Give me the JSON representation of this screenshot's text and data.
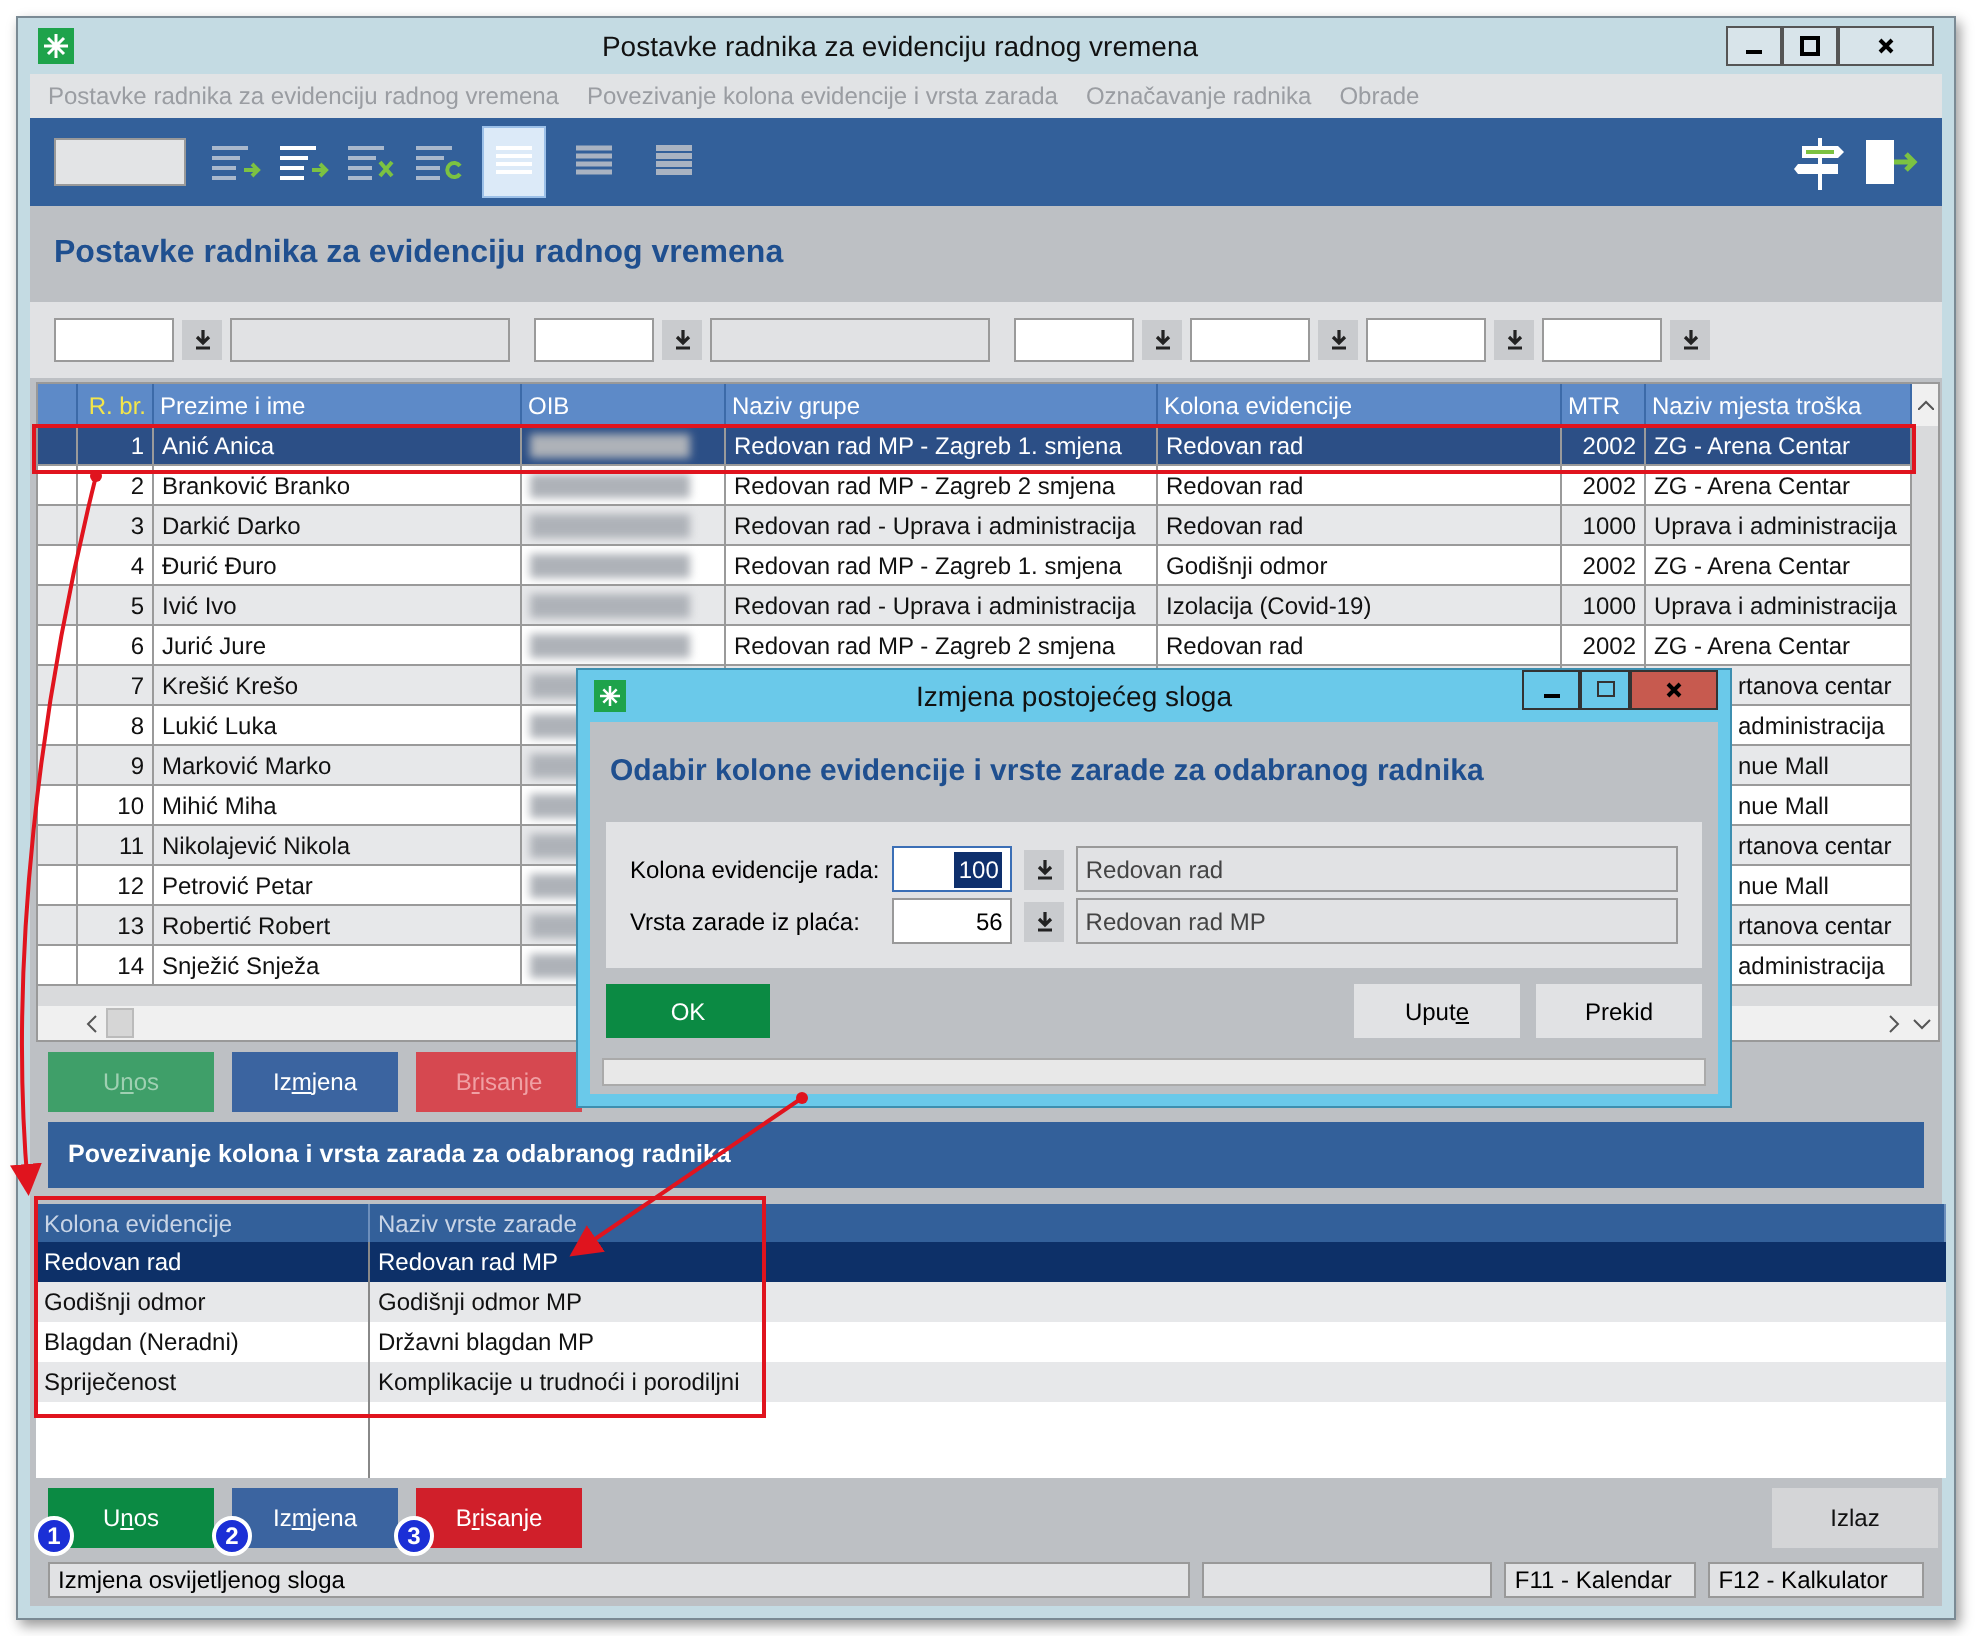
{
  "window": {
    "title": "Postavke radnika za evidenciju radnog vremena"
  },
  "menu": [
    "Postavke radnika za evidenciju radnog vremena",
    "Povezivanje kolona evidencije i vrsta zarada",
    "Označavanje radnika",
    "Obrade"
  ],
  "view_buttons": [
    {
      "selected": true
    },
    {
      "selected": false
    },
    {
      "selected": false
    }
  ],
  "section_title": "Postavke radnika za evidenciju radnog vremena",
  "table": {
    "columns": [
      "R. br.",
      "Prezime i ime",
      "OIB",
      "Naziv grupe",
      "Kolona evidencije",
      "MTR",
      "Naziv mjesta troška"
    ],
    "rows": [
      {
        "no": "1",
        "name": "Anić Anica",
        "group": "Redovan rad MP - Zagreb 1. smjena",
        "kolona": "Redovan rad",
        "mtr": "2002",
        "place": "ZG - Arena Centar",
        "selected": true
      },
      {
        "no": "2",
        "name": "Branković Branko",
        "group": "Redovan rad MP - Zagreb 2 smjena",
        "kolona": "Redovan rad",
        "mtr": "2002",
        "place": "ZG - Arena Centar",
        "selected": false
      },
      {
        "no": "3",
        "name": "Darkić Darko",
        "group": "Redovan rad - Uprava i administracija",
        "kolona": "Redovan rad",
        "mtr": "1000",
        "place": "Uprava i administracija",
        "selected": false
      },
      {
        "no": "4",
        "name": "Đurić Đuro",
        "group": "Redovan rad MP - Zagreb 1. smjena",
        "kolona": "Godišnji odmor",
        "mtr": "2002",
        "place": "ZG - Arena Centar",
        "selected": false
      },
      {
        "no": "5",
        "name": "Ivić Ivo",
        "group": "Redovan rad - Uprava i administracija",
        "kolona": "Izolacija (Covid-19)",
        "mtr": "1000",
        "place": "Uprava i administracija",
        "selected": false
      },
      {
        "no": "6",
        "name": "Jurić Jure",
        "group": "Redovan rad MP - Zagreb 2 smjena",
        "kolona": "Redovan rad",
        "mtr": "2002",
        "place": "ZG - Arena Centar",
        "selected": false
      },
      {
        "no": "7",
        "name": "Krešić Krešo",
        "place": "rtanova centar",
        "selected": false
      },
      {
        "no": "8",
        "name": "Lukić Luka",
        "place": "administracija",
        "selected": false
      },
      {
        "no": "9",
        "name": "Marković Marko",
        "place": "nue Mall",
        "selected": false
      },
      {
        "no": "10",
        "name": "Mihić Miha",
        "place": "nue Mall",
        "selected": false
      },
      {
        "no": "11",
        "name": "Nikolajević Nikola",
        "place": "rtanova centar",
        "selected": false
      },
      {
        "no": "12",
        "name": "Petrović Petar",
        "place": "nue Mall",
        "selected": false
      },
      {
        "no": "13",
        "name": "Robertić Robert",
        "place": "rtanova centar",
        "selected": false
      },
      {
        "no": "14",
        "name": "Snježić Snježa",
        "place": "administracija",
        "selected": false
      }
    ]
  },
  "top_buttons": [
    {
      "label": "Unos",
      "kind": "add",
      "disabled": true
    },
    {
      "label": "Izmjena",
      "kind": "edit",
      "disabled": false
    },
    {
      "label": "Brisanje",
      "kind": "delete",
      "disabled": true
    }
  ],
  "link_section_title": "Povezivanje kolona i vrsta zarada za odabranog radnika",
  "link_table": {
    "columns": [
      "Kolona evidencije",
      "Naziv vrste zarade"
    ],
    "rows": [
      {
        "kolona": "Redovan rad",
        "zarada": "Redovan rad MP",
        "selected": true
      },
      {
        "kolona": "Godišnji odmor",
        "zarada": "Godišnji odmor MP",
        "selected": false
      },
      {
        "kolona": "Blagdan (Neradni)",
        "zarada": "Državni blagdan MP",
        "selected": false
      },
      {
        "kolona": "Spriječenost",
        "zarada": "Komplikacije u trudnoći i porodiljni",
        "selected": false
      }
    ]
  },
  "bottom_buttons": [
    {
      "label": "Unos",
      "kind": "add",
      "disabled": false
    },
    {
      "label": "Izmjena",
      "kind": "edit",
      "disabled": false
    },
    {
      "label": "Brisanje",
      "kind": "delete",
      "disabled": false
    }
  ],
  "exit_button": "Izlaz",
  "markers": [
    "1",
    "2",
    "3"
  ],
  "status_bar": [
    "Izmjena osvijetljenog sloga",
    "F11 - Kalendar",
    "F12 - Kalkulator"
  ],
  "dialog": {
    "title": "Izmjena postojećeg sloga",
    "heading": "Odabir kolone evidencije i vrste zarade za odabranog radnika",
    "fields": [
      {
        "label": "Kolona evidencije rada:",
        "value": "100",
        "selected": true,
        "description": "Redovan rad"
      },
      {
        "label": "Vrsta zarade iz plaća:",
        "value": "56",
        "selected": false,
        "description": "Redovan rad MP"
      }
    ],
    "ok": "OK",
    "help": "Upute",
    "cancel": "Prekid"
  }
}
